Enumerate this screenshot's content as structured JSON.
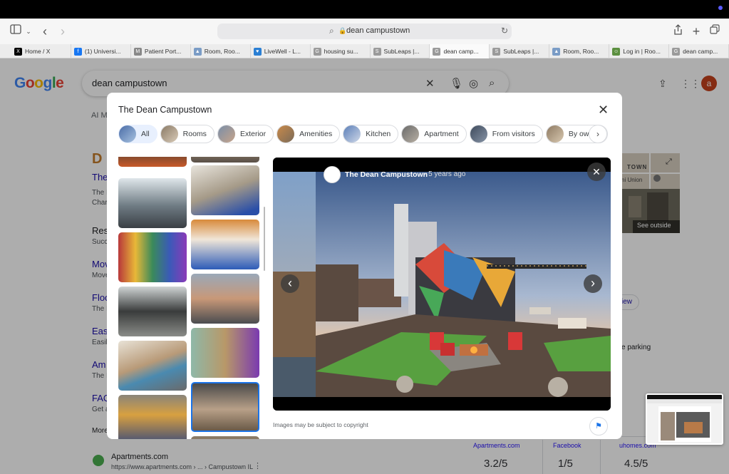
{
  "browser": {
    "address": "dean campustown",
    "tabs": [
      {
        "label": "Home / X",
        "color": "#000000",
        "glyph": "X"
      },
      {
        "label": "(1) Universi...",
        "color": "#1877f2",
        "glyph": "f"
      },
      {
        "label": "Patient Port...",
        "color": "#888888",
        "glyph": "M"
      },
      {
        "label": "Room, Roo...",
        "color": "#7a9cc6",
        "glyph": "▲"
      },
      {
        "label": "LiveWell - L...",
        "color": "#2a7fd4",
        "glyph": "♥"
      },
      {
        "label": "housing su...",
        "color": "#9a9a9a",
        "glyph": "G"
      },
      {
        "label": "SubLeaps |...",
        "color": "#9a9a9a",
        "glyph": "S"
      },
      {
        "label": "dean camp...",
        "color": "#9a9a9a",
        "glyph": "G"
      },
      {
        "label": "SubLeaps |...",
        "color": "#9a9a9a",
        "glyph": "S"
      },
      {
        "label": "Room, Roo...",
        "color": "#7a9cc6",
        "glyph": "▲"
      },
      {
        "label": "Log in | Roo...",
        "color": "#5b8f3f",
        "glyph": "☺"
      },
      {
        "label": "dean camp...",
        "color": "#9a9a9a",
        "glyph": "G"
      }
    ]
  },
  "google": {
    "logo": "Google",
    "query": "dean campustown",
    "avatar_letter": "a",
    "behind": {
      "tab_ai": "AI M",
      "d": "D",
      "items": [
        "The",
        "Res",
        "Mov",
        "Floo",
        "Eas",
        "Am",
        "FAQ",
        "More"
      ],
      "subs": [
        "The I",
        "Char",
        "Succ",
        "Move",
        "The I",
        "Easil",
        "The I",
        "Get a"
      ],
      "see_outside": "See outside",
      "map_label": "TOWN",
      "map_sub": "ni Union",
      "view_btn": "iew",
      "parking": "e parking",
      "result_site": "Apartments.com",
      "result_url": "https://www.apartments.com › ... › Campustown IL",
      "ratings": [
        {
          "source": "Apartments.com",
          "value": "3.2/5"
        },
        {
          "source": "Facebook",
          "value": "1/5"
        },
        {
          "source": "uhomes.com",
          "value": "4.5/5"
        }
      ]
    }
  },
  "modal": {
    "title": "The Dean Campustown",
    "chips": [
      "All",
      "Rooms",
      "Exterior",
      "Amenities",
      "Kitchen",
      "Apartment",
      "From visitors",
      "By owner"
    ],
    "viewer": {
      "source": "The Dean Campustown",
      "age": "5 years ago"
    },
    "copyright": "Images may be subject to copyright"
  }
}
